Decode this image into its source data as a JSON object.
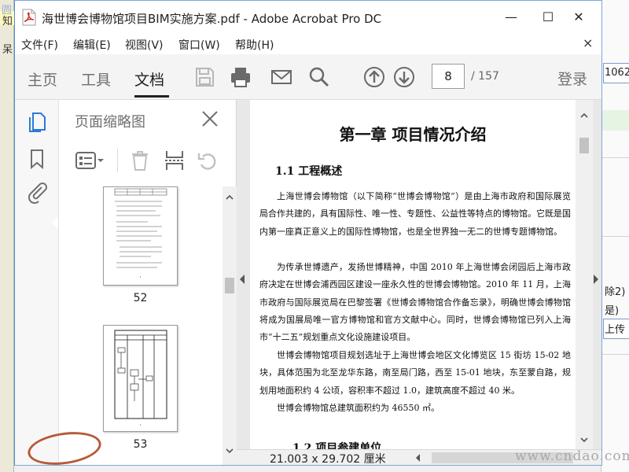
{
  "window": {
    "title": "海世博会博物馆项目BIM实施方案.pdf - Adobe Acrobat Pro DC",
    "buttons": {
      "minimize": "—",
      "maximize": "☐",
      "close": "✕"
    }
  },
  "menu": [
    "文件(F)",
    "编辑(E)",
    "视图(V)",
    "窗口(W)",
    "帮助(H)"
  ],
  "menu_close": "×",
  "tabs": {
    "home": "主页",
    "tools": "工具",
    "document": "文档"
  },
  "toolbar": {
    "icons": [
      "save-icon",
      "print-icon",
      "email-icon",
      "search-icon",
      "page-up-icon",
      "page-down-icon"
    ],
    "page_number": "8",
    "page_total": "/ 157",
    "login": "登录"
  },
  "rail": {
    "icons": [
      "pages-icon",
      "bookmark-icon",
      "attachment-icon"
    ]
  },
  "thumbnails_panel": {
    "title": "页面缩略图",
    "tools": [
      "options-icon",
      "delete-icon",
      "insert-page-icon",
      "undo-icon"
    ],
    "pages": [
      {
        "label": "52"
      },
      {
        "label": "53"
      }
    ]
  },
  "document": {
    "chapter_title": "第一章  项目情况介绍",
    "section_title": "1.1  工程概述",
    "paragraphs": [
      "上海世博会博物馆（以下简称“世博会博物馆”）是由上海市政府和国际展览局合作共建的，具有国际性、唯一性、专题性、公益性等特点的博物馆。它既是国内第一座真正意义上的国际性博物馆，也是全世界独一无二的世博专题博物馆。",
      "为传承世博遗产，发扬世博精神，中国 2010 年上海世博会闭园后上海市政府决定在世博会浦西园区建设一座永久性的世博会博物馆。2010 年 11 月，上海市政府与国际展览局在巴黎签署《世博会博物馆合作备忘录》，明确世博会博物馆将成为国展局唯一官方博物馆和官方文献中心。同时，世博会博物馆已列入上海市“十二五”规划重点文化设施建设项目。",
      "世博会博物馆项目规划选址于上海世博会地区文化博览区 15 街坊 15-02 地块，具体范围为北至龙华东路，南至局门路，西至 15-01 地块，东至蒙自路，规划用地面积约 4 公顷，容积率不超过 1.0，建筑高度不超过 40 米。",
      "世博会博物馆总建筑面积约为 46550 ㎡。"
    ],
    "next_section_title": "1.2  项目参建单位",
    "page_size": "21.003 x 29.702 厘米"
  },
  "background": {
    "left_chars": [
      "知",
      "呆"
    ],
    "right_texts": [
      "1062",
      "除2)",
      "是)",
      "上传"
    ],
    "watermark_top": "圆 通 扬 网",
    "watermark_bottom": "www.cndao.com"
  }
}
